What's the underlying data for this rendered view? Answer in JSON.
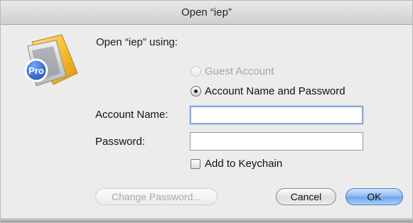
{
  "window": {
    "title": "Open “iep”"
  },
  "app_icon": {
    "badge_text": "Pro",
    "icon": "keynote-pro-icon"
  },
  "dialog": {
    "prompt": "Open “iep” using:",
    "options": [
      {
        "label": "Guest Account",
        "selected": false,
        "enabled": false
      },
      {
        "label": "Account Name and Password",
        "selected": true,
        "enabled": true
      }
    ],
    "account_name": {
      "label": "Account Name:",
      "value": ""
    },
    "password": {
      "label": "Password:",
      "value": ""
    },
    "keychain": {
      "label": "Add to Keychain",
      "checked": false
    }
  },
  "buttons": {
    "change_password": "Change Password...",
    "cancel": "Cancel",
    "ok": "OK"
  }
}
